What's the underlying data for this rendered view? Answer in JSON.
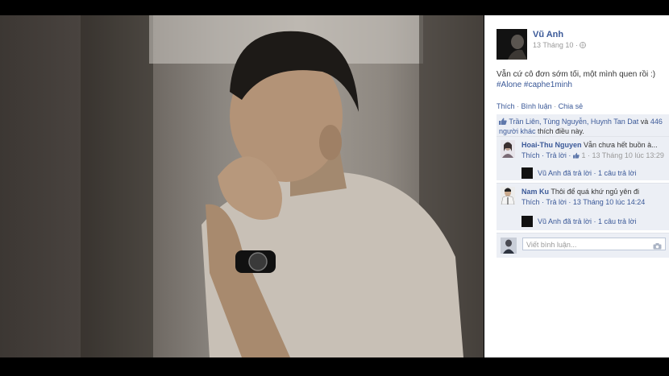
{
  "post": {
    "author": "Vũ Anh",
    "date": "13 Tháng 10 ·",
    "status": "Vẫn cứ cô đơn sớm tối, một mình quen rồi :)",
    "tags": "#Alone #caphe1minh"
  },
  "actions": {
    "like": "Thích",
    "comment": "Bình luận",
    "share": "Chia sẻ",
    "sep": "·"
  },
  "likes": {
    "names": "Trần Liên, Tùng Nguyễn, Huynh Tan Dat",
    "and": " và",
    "others": "446 người khác",
    "suffix": " thích điều này."
  },
  "comments": [
    {
      "name": "Hoai-Thu Nguyen",
      "text": " Vẫn chưa hết buồn à...",
      "actions": "Thích · Trả lời · ",
      "like_count": "1",
      "time": " · 13 Tháng 10 lúc 13:29",
      "reply": "Vũ Anh đã trả lời · 1 câu trả lời"
    },
    {
      "name": "Nam Ku",
      "text": " Thôi để quá khứ ngủ yên đi",
      "actions": "Thích · Trả lời · 13 Tháng 10 lúc 14:24",
      "reply": "Vũ Anh đã trả lời · 1 câu trả lời"
    }
  ],
  "write_comment": {
    "placeholder": "Viết bình luận..."
  },
  "icons": {
    "globe": "globe-icon",
    "like": "thumbs-up-icon",
    "camera": "camera-icon"
  },
  "colors": {
    "link": "#3b5998",
    "comment_bg": "#eceff5",
    "frame": "#000000"
  }
}
